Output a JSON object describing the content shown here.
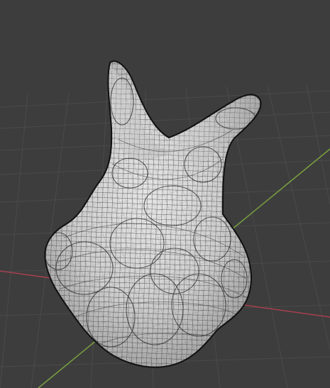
{
  "viewport": {
    "background": "#3d3d3d",
    "grid_color": "#4a4a4a",
    "x_axis_color": "#a7404f",
    "y_axis_color": "#7aa13f",
    "mesh_fill": "#cfcfcf",
    "mesh_shade": "#9f9f9f",
    "wire_color": "#242424"
  }
}
